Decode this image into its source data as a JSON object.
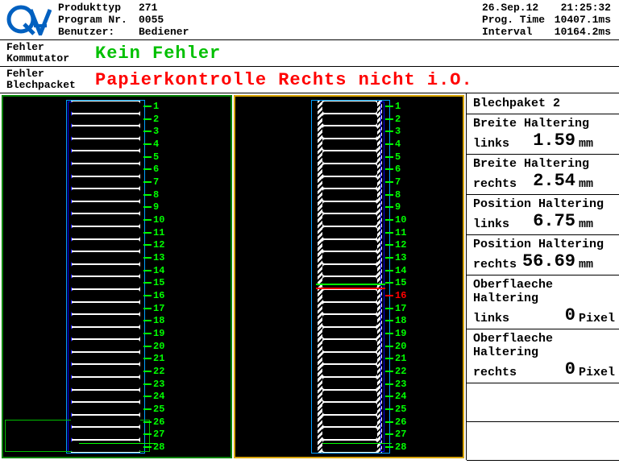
{
  "header": {
    "left": {
      "produkt_lbl": "Produkttyp",
      "produkt_val": "271",
      "program_lbl": "Program Nr.",
      "program_val": "0055",
      "benutzer_lbl": "Benutzer:",
      "benutzer_val": "Bediener"
    },
    "right": {
      "date": "26.Sep.12",
      "time": "21:25:32",
      "progtime_lbl": "Prog. Time",
      "progtime_val": "10407.1ms",
      "interval_lbl": "Interval",
      "interval_val": "10164.2ms"
    }
  },
  "status": {
    "komm_lbl1": "Fehler",
    "komm_lbl2": "Kommutator",
    "komm_val": "Kein Fehler",
    "blech_lbl1": "Fehler",
    "blech_lbl2": "Blechpacket",
    "blech_val": "Papierkontrolle Rechts nicht i.O."
  },
  "side": {
    "title": "Blechpaket 2",
    "m": [
      {
        "lbl": "Breite Haltering",
        "sub": "links",
        "val": "1.59",
        "unit": "mm"
      },
      {
        "lbl": "Breite Haltering",
        "sub": "rechts",
        "val": "2.54",
        "unit": "mm"
      },
      {
        "lbl": "Position Haltering",
        "sub": "links",
        "val": "6.75",
        "unit": "mm"
      },
      {
        "lbl": "Position Haltering",
        "sub": "rechts",
        "val": "56.69",
        "unit": "mm"
      },
      {
        "lbl": "Oberflaeche Haltering",
        "sub": "links",
        "val": "0",
        "unit": "Pixel"
      },
      {
        "lbl": "Oberflaeche Haltering",
        "sub": "rechts",
        "val": "0",
        "unit": "Pixel"
      }
    ]
  },
  "pane": {
    "count": 28,
    "defect": 16
  }
}
